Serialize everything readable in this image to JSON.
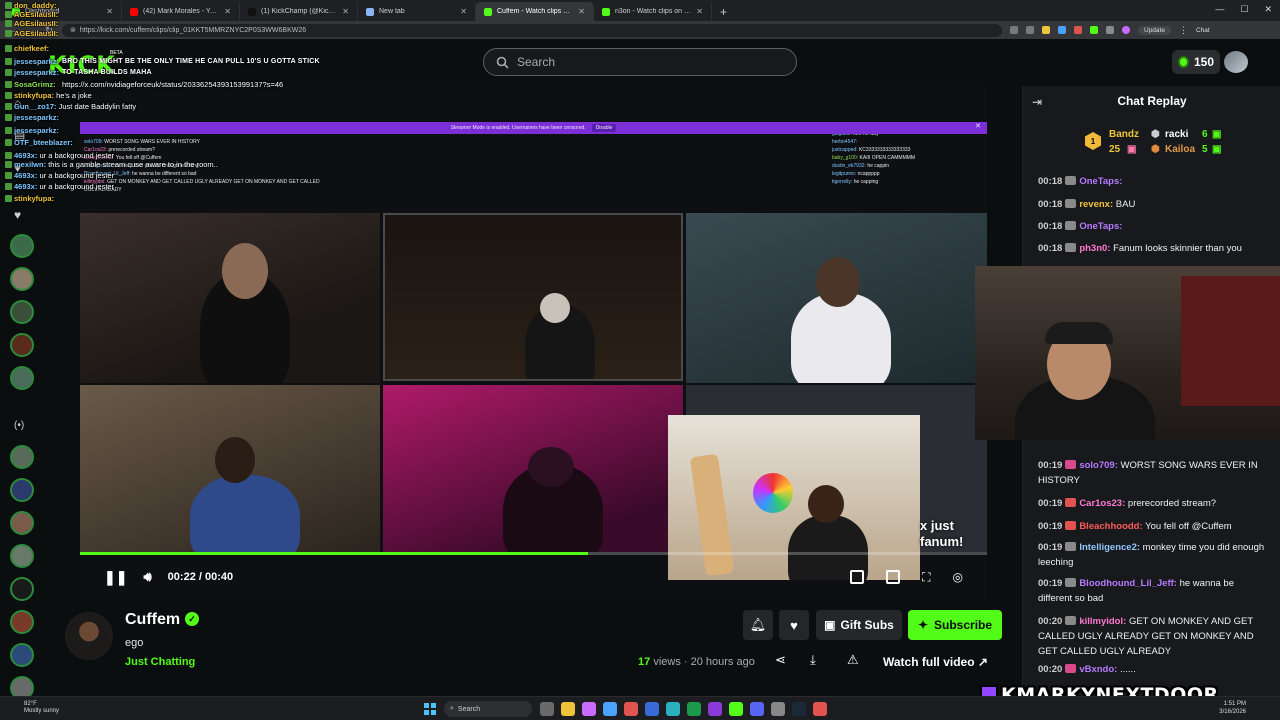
{
  "browser": {
    "tabs": [
      {
        "label": "Dashboard",
        "color": "#53fc18"
      },
      {
        "label": "(42) Mark Morales - YouTube",
        "color": "#ff0000"
      },
      {
        "label": "(1) KickChamp (@Kick_Champ...",
        "color": "#111111"
      },
      {
        "label": "New tab",
        "color": "#8ab4f8"
      },
      {
        "label": "Cuffem - Watch clips on Kick",
        "color": "#53fc18"
      },
      {
        "label": "n3on - Watch clips on Kick",
        "color": "#53fc18"
      }
    ],
    "url": "https://kick.com/cuffem/clips/clip_01KKT5MMRZNYC2P0S3WW6BKW26",
    "update_label": "Update",
    "chat_label": "Chat"
  },
  "header": {
    "logo": "KICK",
    "beta": "BETA",
    "search_placeholder": "Search",
    "points": "150"
  },
  "overlay_chat": {
    "tweet_text": "BRO THIS MIGHT BE THE ONLY TIME HE CAN PULL 10'S U GOTTA STICK TO TASHA BUILDS MAHA",
    "link": "https://x.com/nvidiageforceuk/status/2033625439315399137?s=46",
    "lines": [
      {
        "user": "don_daddy:",
        "text": "",
        "cls": "gold"
      },
      {
        "user": "AGEsilausII:",
        "text": "",
        "cls": "gold"
      },
      {
        "user": "AGEsilausII:",
        "text": "",
        "cls": "gold"
      },
      {
        "user": "AGEsilausII:",
        "text": "",
        "cls": "gold"
      },
      {
        "user": "chiefkeef:",
        "text": "",
        "cls": "gold"
      },
      {
        "user": "jessesparkz:",
        "text": "",
        "cls": ""
      },
      {
        "user": "jessesparkz:",
        "text": "",
        "cls": ""
      },
      {
        "user": "SosaGrimz:",
        "text": "",
        "cls": "green"
      },
      {
        "user": "stinkyfupa:",
        "text": "he's a joke",
        "cls": "gold"
      },
      {
        "user": "Gun__zo17:",
        "text": "Just date Baddylin fatty",
        "cls": ""
      },
      {
        "user": "jessesparkz:",
        "text": "",
        "cls": ""
      },
      {
        "user": "jessesparkz:",
        "text": "",
        "cls": ""
      },
      {
        "user": "OTF_bteeblazer:",
        "text": "",
        "cls": ""
      },
      {
        "user": "4693x:",
        "text": "ur a background jester",
        "cls": ""
      },
      {
        "user": "mexilwn:",
        "text": "this is a gamble stream cuse aware to in the room..",
        "cls": ""
      },
      {
        "user": "4693x:",
        "text": "ur a background jester",
        "cls": ""
      },
      {
        "user": "4693x:",
        "text": "ur a background jester",
        "cls": ""
      },
      {
        "user": "stinkyfupa:",
        "text": "",
        "cls": "gold"
      }
    ]
  },
  "stream": {
    "banner_text": "Streamer Mode is enabled. Usernames have been censored.",
    "banner_button": "Disable",
    "left_chat": [
      {
        "u": "solo709:",
        "t": "WORST SONG WARS EVER IN HISTORY",
        "c": ""
      },
      {
        "u": "Car1os23:",
        "t": "prerecorded stream?",
        "c": "pink"
      },
      {
        "u": "Bleachhoodd:",
        "t": "You fell off @Cuffem",
        "c": "pink"
      },
      {
        "u": "Intelligence2:",
        "t": "monkey time you did enough leeching",
        "c": ""
      },
      {
        "u": "Bloodhound_Lil_Jeff:",
        "t": "he wanna be different so bad",
        "c": ""
      },
      {
        "u": "killmyidol:",
        "t": "GET ON MONKEY AND GET CALLED UGLY ALREADY GET ON MONKEY AND GET CALLED UGLY ALREADY",
        "c": "pink"
      }
    ],
    "right_chat": [
      {
        "u": "galgaski:",
        "t": "Aint no way",
        "c": ""
      },
      {
        "u": "herbo4547:",
        "t": "",
        "c": ""
      },
      {
        "u": "justcapped:",
        "t": "KC3333333333333333",
        "c": ""
      },
      {
        "u": "baby_g100:",
        "t": "KAIII OPEN CAMMMMM",
        "c": "green"
      },
      {
        "u": "dustin_ek7932:",
        "t": "he cappin",
        "c": ""
      },
      {
        "u": "legitpunns:",
        "t": "ncappppp",
        "c": ""
      },
      {
        "u": "tigerrelly:",
        "t": "he capping",
        "c": ""
      }
    ],
    "cam_caption": "x just fanum!"
  },
  "player": {
    "current_time": "00:22",
    "separator": "/",
    "duration": "00:40",
    "progress": 0.56
  },
  "clip": {
    "streamer": "Cuffem",
    "title": "ego",
    "category": "Just Chatting",
    "views_count": "17",
    "views_label": "views",
    "age": "20 hours ago",
    "gift_label": "Gift Subs",
    "subscribe_label": "Subscribe",
    "watch_full_label": "Watch full video"
  },
  "chat_replay": {
    "title": "Chat Replay",
    "leaderboard": [
      {
        "rank": "1",
        "name": "Bandz",
        "count": "25"
      },
      {
        "rank": "",
        "name": "racki",
        "count": "6"
      },
      {
        "rank": "",
        "name": "Kailoa",
        "count": "5"
      }
    ],
    "messages": [
      {
        "ts": "00:18",
        "user": "OneTaps:",
        "text": "",
        "color": "#b57bff",
        "badge": "#8a8a8a"
      },
      {
        "ts": "00:18",
        "user": "revenx:",
        "text": "BAU",
        "color": "#f0c43a",
        "badge": "#8a8a8a"
      },
      {
        "ts": "00:18",
        "user": "OneTaps:",
        "text": "",
        "color": "#b57bff",
        "badge": "#8a8a8a"
      },
      {
        "ts": "00:18",
        "user": "ph3n0:",
        "text": "Fanum looks skinnier than you",
        "color": "#ff7ad1",
        "badge": "#8a8a8a"
      },
      {
        "ts": "00:19",
        "user": "solo709:",
        "text": "WORST SONG WARS EVER IN HISTORY",
        "color": "#b57bff",
        "badge": "#d94a8c"
      },
      {
        "ts": "00:19",
        "user": "Car1os23:",
        "text": "prerecorded stream?",
        "color": "#ff7ad1",
        "badge": "#e0534f"
      },
      {
        "ts": "00:19",
        "user": "Bleachhoodd:",
        "text": "You fell off @Cuffem",
        "color": "#ff5a5a",
        "badge": "#e0534f"
      },
      {
        "ts": "00:19",
        "user": "Intelligence2:",
        "text": "monkey time you did enough leeching",
        "color": "#8fc7ff",
        "badge": "#8a8a8a"
      },
      {
        "ts": "00:19",
        "user": "Bloodhound_Lil_Jeff:",
        "text": "he wanna be different so bad",
        "color": "#b57bff",
        "badge": "#8a8a8a"
      },
      {
        "ts": "00:20",
        "user": "killmyidol:",
        "text": "GET ON MONKEY AND GET CALLED UGLY ALREADY GET ON MONKEY AND GET CALLED UGLY ALREADY",
        "color": "#ff7ad1",
        "badge": "#8a8a8a"
      },
      {
        "ts": "00:20",
        "user": "vBxndo:",
        "text": "......",
        "color": "#b57bff",
        "badge": "#d94a8c"
      }
    ]
  },
  "watermark": "KMARKYNEXTDOOR",
  "taskbar": {
    "temp": "82°F",
    "weather": "Mostly sunny",
    "search": "Search",
    "time": "1:51 PM",
    "date": "3/16/2026"
  },
  "colors": {
    "kick_green": "#53fc18",
    "banner_purple": "#7b2fd6",
    "page_bg": "#0b0e0f",
    "chat_bg": "#18191c"
  }
}
